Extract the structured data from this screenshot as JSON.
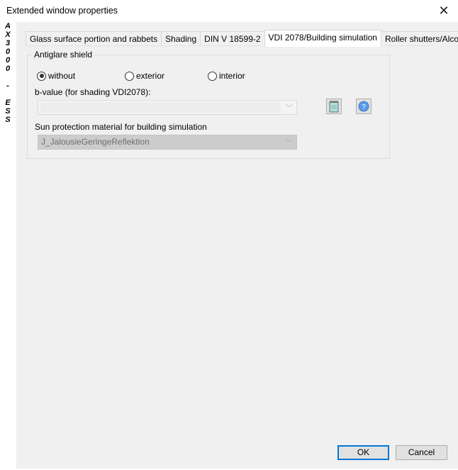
{
  "window": {
    "title": "Extended window properties",
    "close_icon": "close-icon",
    "side_label": [
      "A",
      "X",
      "3",
      "0",
      "0",
      "0",
      "",
      "-",
      "",
      "E",
      "S",
      "S"
    ]
  },
  "tabs": [
    {
      "label": "Glass surface portion and rabbets",
      "active": false
    },
    {
      "label": "Shading",
      "active": false
    },
    {
      "label": "DIN V 18599-2",
      "active": false
    },
    {
      "label": "VDI 2078/Building simulation",
      "active": true
    },
    {
      "label": "Roller shutters/Alcoves",
      "active": false
    }
  ],
  "antiglare": {
    "group_label": "Antiglare shield",
    "options": [
      {
        "label": "without",
        "selected": true
      },
      {
        "label": "exterior",
        "selected": false
      },
      {
        "label": "interior",
        "selected": false
      }
    ],
    "b_value_label": "b-value (for shading VDI2078):",
    "b_value": "",
    "notes_icon": "notepad-icon",
    "help_icon": "help-icon",
    "sun_protection_label": "Sun protection material for building simulation",
    "sun_protection_value": "J_JalousieGeringeReflektion"
  },
  "buttons": {
    "ok": "OK",
    "cancel": "Cancel"
  }
}
